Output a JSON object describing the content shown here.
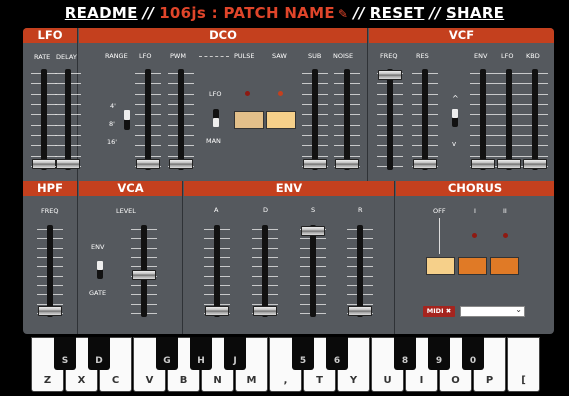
{
  "topbar": {
    "readme": "README",
    "sep": "//",
    "brand": "106js",
    "colon": ":",
    "patch": "PATCH NAME",
    "edit_icon": "✎",
    "reset": "RESET",
    "share": "SHARE"
  },
  "sections": {
    "lfo": "LFO",
    "dco": "DCO",
    "vcf": "VCF",
    "hpf": "HPF",
    "vca": "VCA",
    "env": "ENV",
    "chorus": "CHORUS"
  },
  "labels": {
    "lfo_rate": "RATE",
    "lfo_delay": "DELAY",
    "dco_range": "RANGE",
    "dco_lfo": "LFO",
    "dco_pwm": "PWM",
    "dco_pulse": "PULSE",
    "dco_saw": "SAW",
    "dco_sub": "SUB",
    "dco_noise": "NOISE",
    "range_4": "4'",
    "range_8": "8'",
    "range_16": "16'",
    "pwm_lfo": "LFO",
    "pwm_man": "MAN",
    "vcf_freq": "FREQ",
    "vcf_res": "RES",
    "vcf_env": "ENV",
    "vcf_lfo": "LFO",
    "vcf_kbd": "KBD",
    "vcf_pol_up": "^",
    "vcf_pol_down": "v",
    "hpf_freq": "FREQ",
    "vca_level": "LEVEL",
    "vca_env": "ENV",
    "vca_gate": "GATE",
    "env_a": "A",
    "env_d": "D",
    "env_s": "S",
    "env_r": "R",
    "chorus_off": "OFF",
    "chorus_i": "I",
    "chorus_ii": "II",
    "midi": "MIDI ✖"
  },
  "sliders": {
    "lfo_rate": 0.0,
    "lfo_delay": 0.0,
    "dco_lfo": 0.0,
    "dco_pwm": 0.0,
    "dco_sub": 0.0,
    "dco_noise": 0.0,
    "vcf_freq": 1.0,
    "vcf_res": 0.0,
    "vcf_env": 0.0,
    "vcf_lfo": 0.0,
    "vcf_kbd": 0.0,
    "hpf_freq": 0.0,
    "vca_level": 0.45,
    "env_a": 0.0,
    "env_d": 0.0,
    "env_s": 1.0,
    "env_r": 0.0
  },
  "colors": {
    "accent": "#c4401e",
    "panel": "#55595e",
    "pad_light": "#f6d08a",
    "pad_orange": "#e07a26",
    "led_off": "#8e1a12",
    "led_on": "#c4401e"
  },
  "keyboard": {
    "white": [
      "Z",
      "X",
      "C",
      "V",
      "B",
      "N",
      "M",
      ",",
      "T",
      "Y",
      "U",
      "I",
      "O",
      "P",
      "["
    ],
    "black": [
      "S",
      "D",
      "G",
      "H",
      "J",
      "5",
      "6",
      "8",
      "9",
      "0"
    ]
  }
}
